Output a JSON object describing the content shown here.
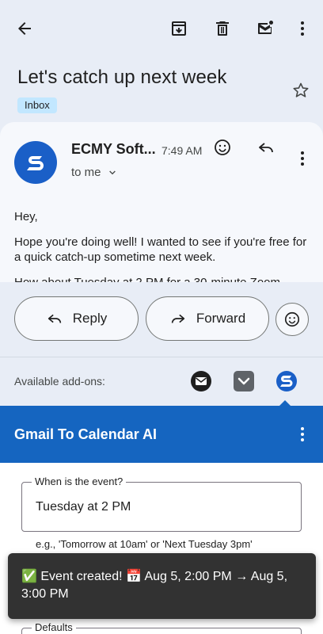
{
  "toolbar": {
    "back_icon": "arrow-back-icon",
    "archive_icon": "archive-icon",
    "delete_icon": "trash-icon",
    "mark_unread_icon": "mail-unread-icon",
    "more_icon": "more-vert-icon"
  },
  "email": {
    "subject": "Let's catch up next week",
    "label": "Inbox",
    "sender": "ECMY Soft...",
    "time": "7:49 AM",
    "to": "to me",
    "body": [
      "Hey,",
      "Hope you're doing well! I wanted to see if you're free for a quick catch-up sometime next week.",
      "How about Tuesday at 2 PM for a 30-minute Zoom"
    ]
  },
  "actions": {
    "reply_label": "Reply",
    "forward_label": "Forward"
  },
  "addons": {
    "label": "Available add-ons:",
    "items": [
      "mail-addon-icon",
      "pocket-addon-icon",
      "gmail-to-calendar-addon-icon"
    ]
  },
  "calendar_addon": {
    "title": "Gmail To Calendar AI",
    "field_legend": "When is the event?",
    "field_value": "Tuesday at 2 PM",
    "helper": "e.g., 'Tomorrow at 10am' or 'Next Tuesday 3pm'",
    "defaults_legend": "Defaults"
  },
  "snackbar": {
    "text": "✅ Event created! 📅 Aug 5, 2:00 PM → Aug 5, 3:00 PM"
  },
  "colors": {
    "accent": "#1565c0",
    "chip": "#c2e7ff",
    "snackbar": "#323232"
  }
}
